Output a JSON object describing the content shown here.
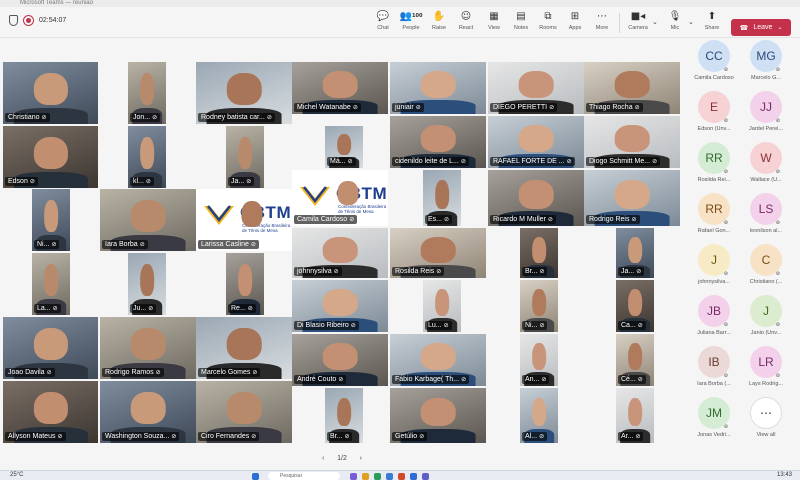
{
  "window": {
    "title": "Microsoft Teams — reunião"
  },
  "toolbar": {
    "timer": "02:54:07",
    "people_count": "100",
    "chat_label": "Chat",
    "people_label": "People",
    "raise_label": "Raise",
    "react_label": "React",
    "view_label": "View",
    "notes_label": "Notes",
    "rooms_label": "Rooms",
    "apps_label": "Apps",
    "more_label": "More",
    "camera_label": "Camera",
    "mic_label": "Mic",
    "share_label": "Share",
    "leave_label": "Leave"
  },
  "tiles": [
    {
      "name": "Christiano"
    },
    {
      "name": "Jon..."
    },
    {
      "name": "Rodney batista car..."
    },
    {
      "name": "Michel Watanabe"
    },
    {
      "name": "juniair"
    },
    {
      "name": "DIEGO PERETTI"
    },
    {
      "name": "Thiago Rocha"
    },
    {
      "name": "Edson"
    },
    {
      "name": "kl..."
    },
    {
      "name": "Ja..."
    },
    {
      "name": "Má..."
    },
    {
      "name": "cidenildo leite de L..."
    },
    {
      "name": "RAFAEL FORTE DE ..."
    },
    {
      "name": "Diogo Schmitt Me..."
    },
    {
      "name": "Larissa Casline",
      "logo_text": "CBTM",
      "logo_sub": "Confederação Brasileira de Tênis de Mesa"
    },
    {
      "name": "Camila Cardoso",
      "logo_text": "CBTM",
      "logo_sub": "Confederação Brasileira de Tênis de Mesa"
    },
    {
      "name": "Ni..."
    },
    {
      "name": "Iara Borba"
    },
    {
      "name": "Es..."
    },
    {
      "name": "Ricardo M Muller"
    },
    {
      "name": "Rodrigo Reis"
    },
    {
      "name": "johnnysilva"
    },
    {
      "name": "Rosilda Reis"
    },
    {
      "name": "Br..."
    },
    {
      "name": "Ja..."
    },
    {
      "name": "La..."
    },
    {
      "name": "Ju..."
    },
    {
      "name": "Re..."
    },
    {
      "name": "Di Blasio Ribeiro"
    },
    {
      "name": "Lu..."
    },
    {
      "name": "Ni..."
    },
    {
      "name": "Ca..."
    },
    {
      "name": "Joao Davila"
    },
    {
      "name": "Rodrigo Ramos"
    },
    {
      "name": "Marcelo Gomes"
    },
    {
      "name": "André Couto"
    },
    {
      "name": "Fábio Karbage( Th..."
    },
    {
      "name": "An..."
    },
    {
      "name": "Cé..."
    },
    {
      "name": "Allyson Mateus"
    },
    {
      "name": "Washington Souza..."
    },
    {
      "name": "Ciro Fernandes"
    },
    {
      "name": "Br..."
    },
    {
      "name": "Getúlio"
    },
    {
      "name": "Al..."
    },
    {
      "name": "Ar..."
    }
  ],
  "pager": {
    "prev": "‹",
    "label": "1/2",
    "next": "›"
  },
  "roster": [
    {
      "initials": "CC",
      "name": "Camila Cardoso",
      "bg": "#cfe0f5",
      "fg": "#2b4a78"
    },
    {
      "initials": "MG",
      "name": "Marcelo G...",
      "bg": "#cfe0f5",
      "fg": "#2b4a78"
    },
    {
      "initials": "E",
      "name": "Edson (Unv...",
      "bg": "#f6d2d4",
      "fg": "#8c2f39"
    },
    {
      "initials": "JJ",
      "name": "Jardel Perei...",
      "bg": "#f3d1ea",
      "fg": "#7a2a66"
    },
    {
      "initials": "RR",
      "name": "Rosilda Rei...",
      "bg": "#d5ecd4",
      "fg": "#2f6b2f"
    },
    {
      "initials": "W",
      "name": "Wallace (U...",
      "bg": "#f6d2d4",
      "fg": "#8c2f39"
    },
    {
      "initials": "RR",
      "name": "Rafael Gon...",
      "bg": "#f7e2c5",
      "fg": "#7a4d12"
    },
    {
      "initials": "LS",
      "name": "leonilson al...",
      "bg": "#f3d1ea",
      "fg": "#7a2a66"
    },
    {
      "initials": "J",
      "name": "johnnysilva...",
      "bg": "#f7ebc5",
      "fg": "#6e5a10"
    },
    {
      "initials": "C",
      "name": "Christiano (...",
      "bg": "#f7e2c5",
      "fg": "#7a4d12"
    },
    {
      "initials": "JB",
      "name": "Juliana Barr...",
      "bg": "#f3d1ea",
      "fg": "#7a2a66"
    },
    {
      "initials": "J",
      "name": "Janio (Unv...",
      "bg": "#dceccf",
      "fg": "#3b6b1f"
    },
    {
      "initials": "IB",
      "name": "Iara Borba (...",
      "bg": "#ead9d6",
      "fg": "#6b3a33"
    },
    {
      "initials": "LR",
      "name": "Lays Rodrig...",
      "bg": "#f3d1ea",
      "fg": "#7a2a66"
    },
    {
      "initials": "JM",
      "name": "Jonas Vedri...",
      "bg": "#d5ecd4",
      "fg": "#2f6b2f"
    },
    {
      "initials": "⋯",
      "name": "View all",
      "bg": "#ffffff",
      "fg": "#333333"
    }
  ],
  "taskbar": {
    "weather": "25°C",
    "search": "Pesquisar",
    "time": "13:43"
  }
}
